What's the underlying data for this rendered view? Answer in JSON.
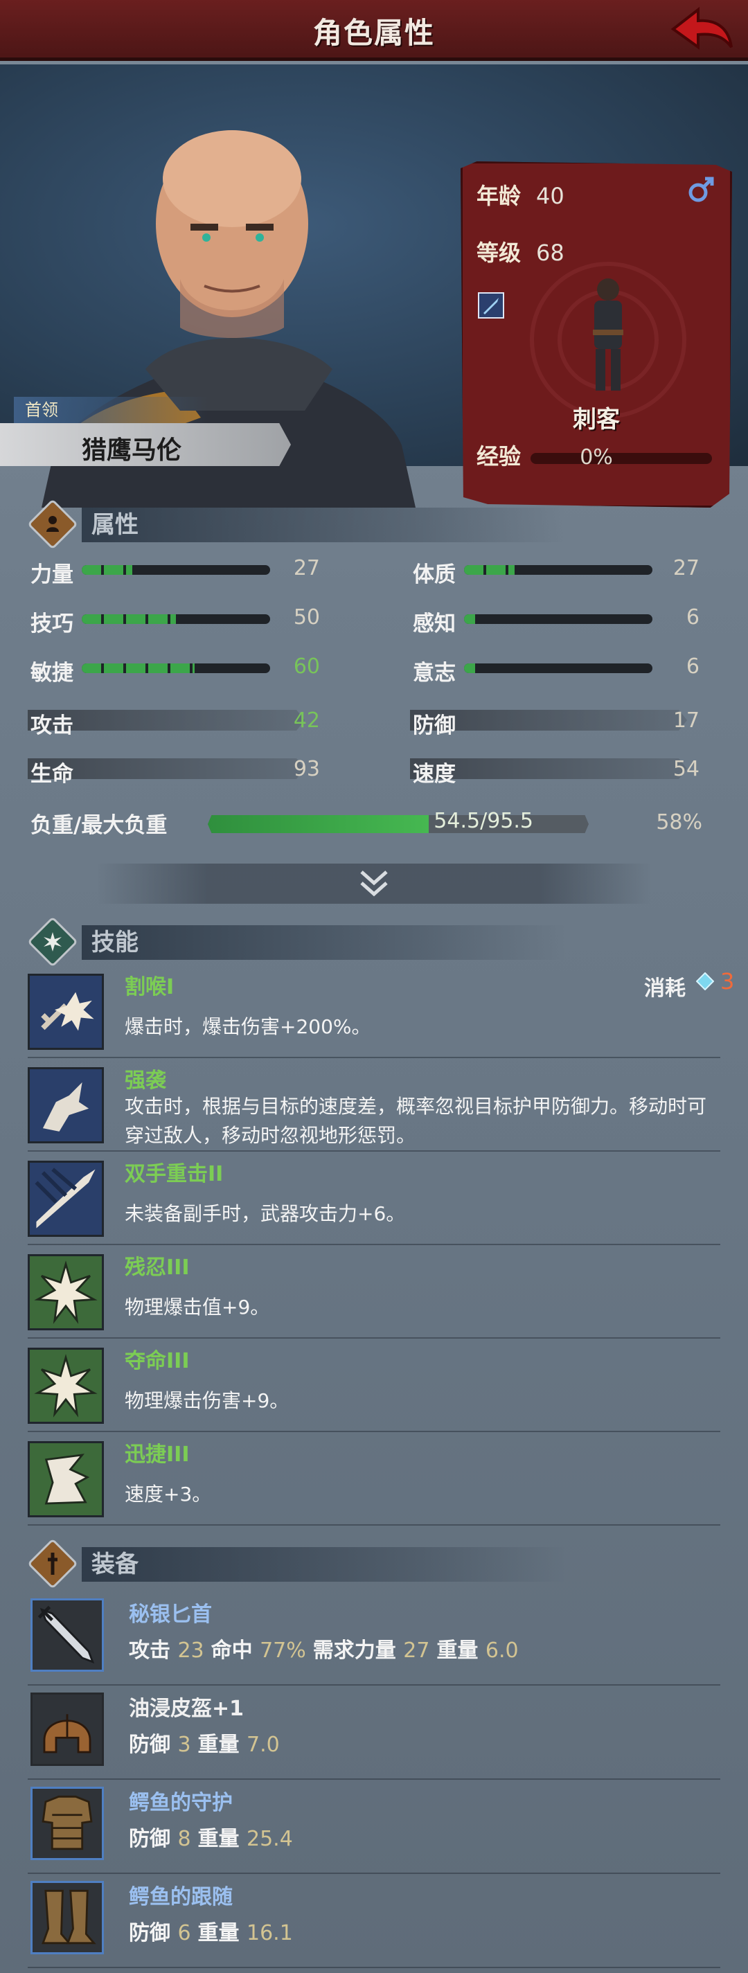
{
  "header": {
    "title": "角色属性"
  },
  "hero": {
    "rank": "首领",
    "name": "猎鹰马伦",
    "info": {
      "age_label": "年龄",
      "age": "40",
      "level_label": "等级",
      "level": "68",
      "class_name": "刺客",
      "exp_label": "经验",
      "exp": "0%",
      "exp_progress": 0
    }
  },
  "attributes": {
    "title": "属性",
    "primary": [
      {
        "label": "力量",
        "value": "27",
        "fill": 0.27
      },
      {
        "label": "技巧",
        "value": "50",
        "fill": 0.5
      },
      {
        "label": "敏捷",
        "value": "60",
        "fill": 0.6
      },
      {
        "label": "体质",
        "value": "27",
        "fill": 0.27
      },
      {
        "label": "感知",
        "value": "6",
        "fill": 0.06
      },
      {
        "label": "意志",
        "value": "6",
        "fill": 0.06
      }
    ],
    "secondary": [
      {
        "label": "攻击",
        "value": "42"
      },
      {
        "label": "生命",
        "value": "93"
      },
      {
        "label": "防御",
        "value": "17"
      },
      {
        "label": "速度",
        "value": "54"
      }
    ],
    "load": {
      "label": "负重/最大负重",
      "value": "54.5/95.5",
      "percent": "58%",
      "fill": 0.58
    }
  },
  "skills": {
    "title": "技能",
    "cost_label": "消耗",
    "cost_value": "3",
    "items": [
      {
        "name": "割喉I",
        "desc": "爆击时，爆击伤害+200%。"
      },
      {
        "name": "强袭",
        "desc": "攻击时，根据与目标的速度差，概率忽视目标护甲防御力。移动时可穿过敌人，移动时忽视地形惩罚。"
      },
      {
        "name": "双手重击II",
        "desc": "未装备副手时，武器攻击力+6。"
      },
      {
        "name": "残忍III",
        "desc": "物理爆击值+9。"
      },
      {
        "name": "夺命III",
        "desc": "物理爆击伤害+9。"
      },
      {
        "name": "迅捷III",
        "desc": "速度+3。"
      }
    ]
  },
  "equipment": {
    "title": "装备",
    "items": [
      {
        "name": "秘银匕首",
        "s1": "攻击",
        "v1": "23",
        "s2": "命中",
        "v2": "77%",
        "s3": "需求力量",
        "v3": "27",
        "s4": "重量",
        "v4": "6.0"
      },
      {
        "name": "油浸皮盔+1",
        "s1": "防御",
        "v1": "3",
        "s2": "重量",
        "v2": "7.0"
      },
      {
        "name": "鳄鱼的守护",
        "s1": "防御",
        "v1": "8",
        "s2": "重量",
        "v2": "25.4"
      },
      {
        "name": "鳄鱼的跟随",
        "s1": "防御",
        "v1": "6",
        "s2": "重量",
        "v2": "16.1"
      }
    ]
  }
}
